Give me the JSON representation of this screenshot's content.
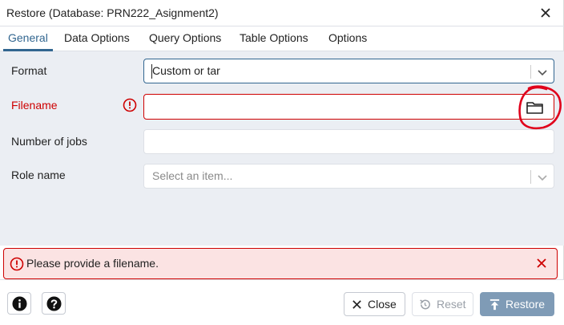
{
  "dialog": {
    "title": "Restore (Database: PRN222_Asignment2)"
  },
  "tabs": [
    {
      "label": "General"
    },
    {
      "label": "Data Options"
    },
    {
      "label": "Query Options"
    },
    {
      "label": "Table Options"
    },
    {
      "label": "Options"
    }
  ],
  "form": {
    "format": {
      "label": "Format",
      "value": "Custom or tar"
    },
    "filename": {
      "label": "Filename",
      "value": ""
    },
    "jobs": {
      "label": "Number of jobs",
      "value": ""
    },
    "role": {
      "label": "Role name",
      "placeholder": "Select an item..."
    }
  },
  "alert": {
    "message": "Please provide a filename."
  },
  "footer": {
    "close_label": "Close",
    "reset_label": "Reset",
    "restore_label": "Restore"
  },
  "colors": {
    "accent": "#326690",
    "error": "#ce0000",
    "annotation": "#e0001b",
    "panel_bg": "#ebeef3"
  },
  "icons": {
    "info": "info-circle-icon",
    "help": "question-circle-icon",
    "folder": "folder-icon"
  }
}
